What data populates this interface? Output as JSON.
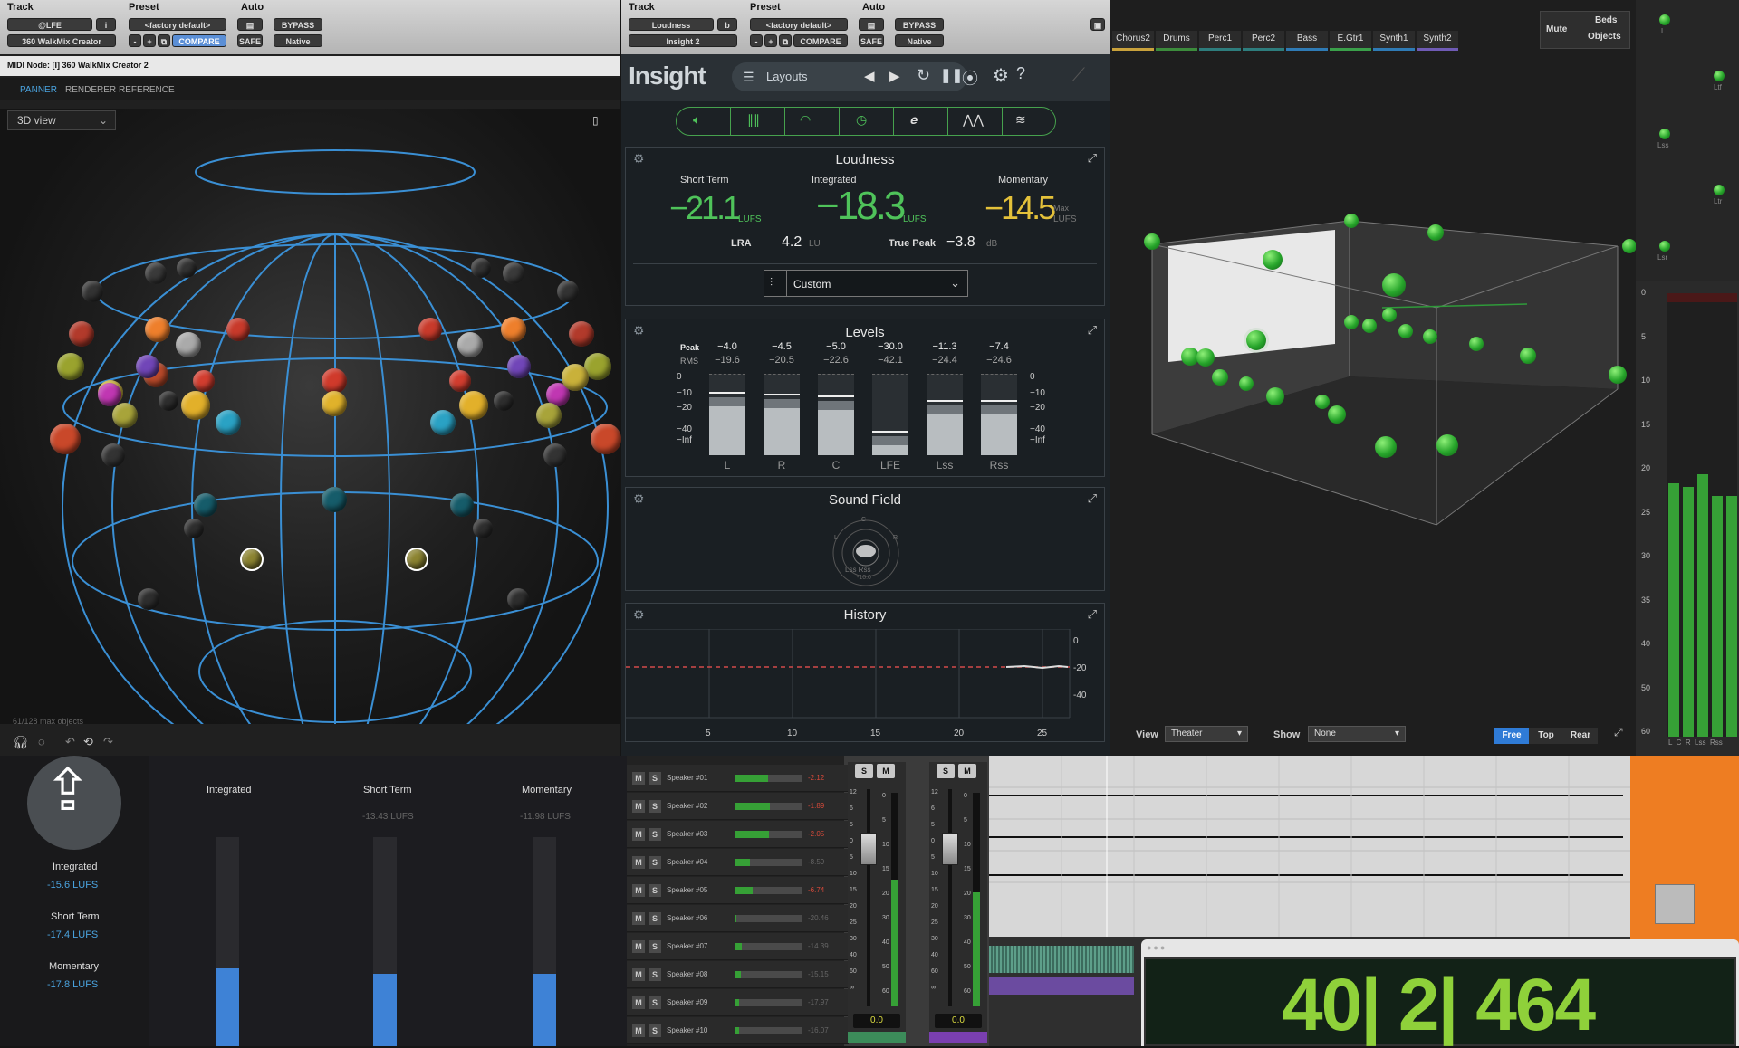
{
  "left_plugin": {
    "header": {
      "track_label": "Track",
      "preset_label": "Preset",
      "auto_label": "Auto",
      "track_value": "@LFE",
      "track_suffix": "i",
      "insert_value": "360 WalkMix Creator",
      "preset_value": "<factory default>",
      "compare": "COMPARE",
      "bypass": "BYPASS",
      "safe": "SAFE",
      "native": "Native",
      "minus": "-",
      "plus": "+"
    },
    "midi_node": "MIDI Node: [I] 360 WalkMix Creator 2",
    "tabs": [
      "PANNER",
      "RENDERER",
      "REFERENCE"
    ],
    "view_select": "3D view",
    "objects_count": "61/128 max objects"
  },
  "insight": {
    "header": {
      "track_label": "Track",
      "preset_label": "Preset",
      "auto_label": "Auto",
      "track_value": "Loudness",
      "track_suffix": "b",
      "insert_value": "Insight 2",
      "preset_value": "<factory default>",
      "compare": "COMPARE",
      "bypass": "BYPASS",
      "safe": "SAFE",
      "native": "Native",
      "minus": "-",
      "plus": "+"
    },
    "title": "Insight",
    "layouts_label": "Layouts",
    "loudness": {
      "title": "Loudness",
      "short_term_label": "Short Term",
      "short_term_value": "−21.1",
      "short_term_unit": "LUFS",
      "integrated_label": "Integrated",
      "integrated_value": "−18.3",
      "integrated_unit": "LUFS",
      "momentary_label": "Momentary",
      "momentary_value": "−14.5",
      "momentary_unit_1": "Max",
      "momentary_unit_2": "LUFS",
      "lra_label": "LRA",
      "lra_value": "4.2",
      "lra_unit": "LU",
      "true_peak_label": "True Peak",
      "true_peak_value": "−3.8",
      "true_peak_unit": "dB",
      "preset": "Custom"
    },
    "levels": {
      "title": "Levels",
      "peak_label": "Peak",
      "rms_label": "RMS",
      "scale": [
        "0",
        "−10",
        "−20",
        "−40",
        "−Inf"
      ],
      "channels": [
        {
          "name": "L",
          "peak": "−4.0",
          "rms": "−19.6",
          "level": 0.6
        },
        {
          "name": "R",
          "peak": "−4.5",
          "rms": "−20.5",
          "level": 0.58
        },
        {
          "name": "C",
          "peak": "−5.0",
          "rms": "−22.6",
          "level": 0.55
        },
        {
          "name": "LFE",
          "peak": "−30.0",
          "rms": "−42.1",
          "level": 0.12
        },
        {
          "name": "Lss",
          "peak": "−11.3",
          "rms": "−24.4",
          "level": 0.5
        },
        {
          "name": "Rss",
          "peak": "−7.4",
          "rms": "−24.6",
          "level": 0.5
        }
      ]
    },
    "sound_field": {
      "title": "Sound Field",
      "l": "L",
      "c": "C",
      "r": "R",
      "bottom": "Lss  Rss",
      "value": "-10.0"
    },
    "history": {
      "title": "History",
      "yticks": [
        "0",
        "-20",
        "-40"
      ],
      "xticks": [
        "5",
        "10",
        "15",
        "20",
        "25"
      ]
    }
  },
  "room": {
    "tabs": [
      {
        "label": "Chorus2",
        "color": "#c9a23c"
      },
      {
        "label": "Drums",
        "color": "#3c8c3c"
      },
      {
        "label": "Perc1",
        "color": "#2e7d7d"
      },
      {
        "label": "Perc2",
        "color": "#2e7d7d"
      },
      {
        "label": "Bass",
        "color": "#2f7bb5"
      },
      {
        "label": "E.Gtr1",
        "color": "#3aa04a"
      },
      {
        "label": "Synth1",
        "color": "#2f7bb5"
      },
      {
        "label": "Synth2",
        "color": "#6f5bb5"
      }
    ],
    "mute_label": "Mute",
    "beds_label": "Beds",
    "objects_label": "Objects",
    "view_label": "View",
    "view_value": "Theater",
    "show_label": "Show",
    "show_value": "None",
    "buttons": [
      "Free",
      "Top",
      "Rear"
    ]
  },
  "right_meters": {
    "speakers": [
      "L",
      "Ltf",
      "Lss",
      "Ltr",
      "Lsr"
    ],
    "scale": [
      "0",
      "5",
      "10",
      "15",
      "20",
      "25",
      "30",
      "35",
      "40",
      "50",
      "60"
    ],
    "labels": "L  C  R  Lss  Rss"
  },
  "bottom_left": {
    "integrated_label": "Integrated",
    "integrated_value": "-15.6 LUFS",
    "short_term_label": "Short Term",
    "short_term_value": "-17.4 LUFS",
    "momentary_label": "Momentary",
    "momentary_value": "-17.8 LUFS",
    "col_integrated": "Integrated",
    "col_short_term": "Short Term",
    "col_short_value": "-13.43 LUFS",
    "col_momentary": "Momentary",
    "col_momentary_value": "-11.98 LUFS"
  },
  "speaker_rows": [
    {
      "name": "Speaker #01",
      "value": "-2.12",
      "level": 0.48
    },
    {
      "name": "Speaker #02",
      "value": "-1.89",
      "level": 0.52
    },
    {
      "name": "Speaker #03",
      "value": "-2.05",
      "level": 0.5
    },
    {
      "name": "Speaker #04",
      "value": "-8.59",
      "level": 0.22
    },
    {
      "name": "Speaker #05",
      "value": "-6.74",
      "level": 0.25
    },
    {
      "name": "Speaker #06",
      "value": "-20.46",
      "level": 0.02
    },
    {
      "name": "Speaker #07",
      "value": "-14.39",
      "level": 0.1
    },
    {
      "name": "Speaker #08",
      "value": "-15.15",
      "level": 0.08
    },
    {
      "name": "Speaker #09",
      "value": "-17.97",
      "level": 0.05
    },
    {
      "name": "Speaker #10",
      "value": "-16.07",
      "level": 0.06
    }
  ],
  "faders": {
    "s": "S",
    "m": "M",
    "value_1": "0.0",
    "value_2": "0.0",
    "scale": [
      "12",
      "6",
      "5",
      "0",
      "5",
      "10",
      "15",
      "20",
      "25",
      "30",
      "40",
      "60",
      "∞"
    ],
    "meter_scale": [
      "0",
      "5",
      "10",
      "15",
      "20",
      "30",
      "40",
      "50",
      "60"
    ]
  },
  "counter": "40| 2| 464",
  "colors": {
    "green": "#4fc35a",
    "yellow": "#e4c13a",
    "blue_meter": "#3e82d6",
    "counter": "#8fd13a"
  }
}
